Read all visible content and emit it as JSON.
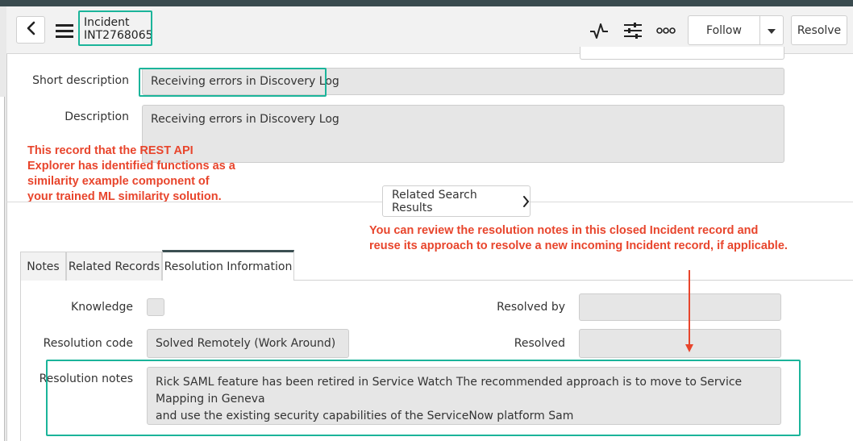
{
  "header": {
    "record_type": "Incident",
    "record_number": "INT2768065",
    "follow_label": "Follow",
    "resolve_label": "Resolve"
  },
  "icons": {
    "back": "back-chevron-icon",
    "menu": "hamburger-menu-icon",
    "activity": "activity-pulse-icon",
    "settings": "sliders-settings-icon",
    "more": "more-options-icon",
    "dropdown": "caret-down-icon",
    "related_search": "chevron-right-icon"
  },
  "form": {
    "short_description_label": "Short description",
    "short_description_value": "Receiving errors in Discovery Log",
    "description_label": "Description",
    "description_value": "Receiving errors in Discovery Log",
    "related_search_label": "Related Search Results"
  },
  "tabs": [
    {
      "label": "Notes"
    },
    {
      "label": "Related Records"
    },
    {
      "label": "Resolution Information"
    }
  ],
  "resolution": {
    "knowledge_label": "Knowledge",
    "resolution_code_label": "Resolution code",
    "resolution_code_value": "Solved Remotely (Work Around)",
    "resolution_notes_label": "Resolution notes",
    "resolution_notes_line1": "Rick SAML feature has been retired in Service Watch  The recommended approach is to move to Service Mapping in Geneva",
    "resolution_notes_line2": "and use the existing security capabilities of the ServiceNow platform  Sam",
    "resolved_by_label": "Resolved by",
    "resolved_label": "Resolved"
  },
  "annotations": {
    "left": [
      "This record that the REST API",
      "Explorer has identified functions as a",
      "similarity example component of",
      "your trained ML similarity solution."
    ],
    "right": [
      "You can review the resolution notes in this closed Incident record and",
      "reuse its approach to resolve a new incoming Incident record, if applicable."
    ]
  },
  "colors": {
    "highlight": "#1bb49a",
    "annotation": "#e8452c",
    "field_bg": "#e6e6e6",
    "header_bg": "#f2f2f2"
  }
}
